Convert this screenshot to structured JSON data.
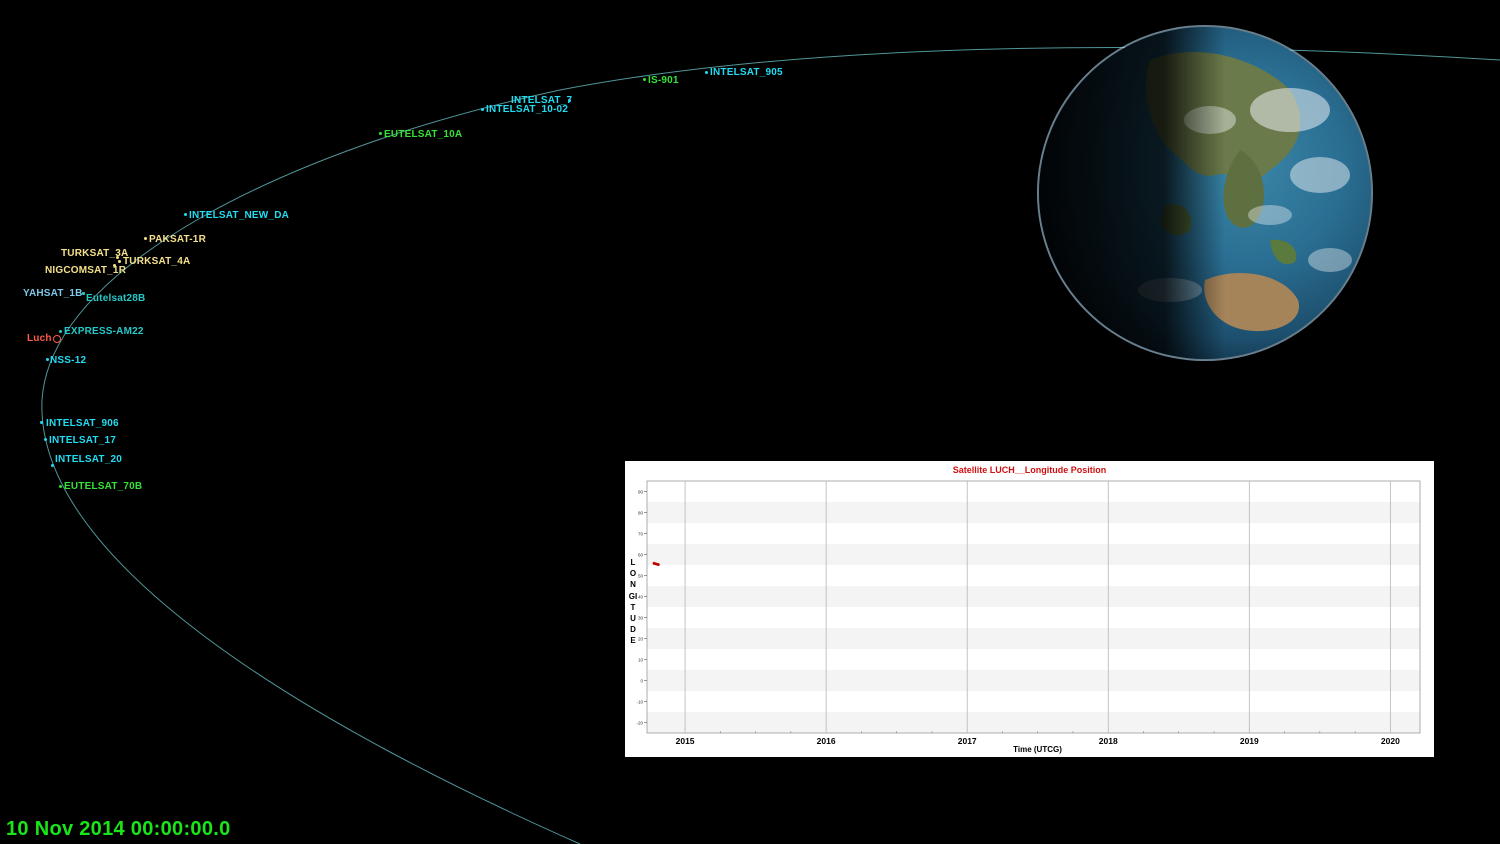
{
  "timestamp": "10 Nov 2014 00:00:00.0",
  "colors": {
    "orbit": "#5fb0b4",
    "cyan": "#22dcf2",
    "green": "#35e235",
    "yellow": "#f4e08a",
    "light_blue": "#7fc8ea",
    "teal": "#25c9c9",
    "luch": "#ff5a4a",
    "chart_red": "#c00000"
  },
  "satellites": [
    {
      "name": "INTELSAT_905",
      "color": "cyan"
    },
    {
      "name": "IS-901",
      "color": "green"
    },
    {
      "name": "INTELSAT_7",
      "color": "cyan"
    },
    {
      "name": "INTELSAT_10-02",
      "color": "cyan"
    },
    {
      "name": "EUTELSAT_10A",
      "color": "green"
    },
    {
      "name": "INTELSAT_NEW_DA",
      "color": "cyan"
    },
    {
      "name": "PAKSAT-1R",
      "color": "yellow"
    },
    {
      "name": "TURKSAT_3A",
      "color": "yellow"
    },
    {
      "name": "TURKSAT_4A",
      "color": "yellow"
    },
    {
      "name": "NIGCOMSAT_1R",
      "color": "yellow"
    },
    {
      "name": "YAHSAT_1B",
      "color": "light_blue"
    },
    {
      "name": "Eutelsat28B",
      "color": "teal"
    },
    {
      "name": "EXPRESS-AM22",
      "color": "teal"
    },
    {
      "name": "Luch",
      "color": "luch"
    },
    {
      "name": "NSS-12",
      "color": "cyan"
    },
    {
      "name": "INTELSAT_906",
      "color": "cyan"
    },
    {
      "name": "INTELSAT_17",
      "color": "cyan"
    },
    {
      "name": "INTELSAT_20",
      "color": "cyan"
    },
    {
      "name": "EUTELSAT_70B",
      "color": "green"
    }
  ],
  "chart_data": {
    "type": "scatter",
    "title": "Satellite LUCH__Longitude Position",
    "xlabel": "Time (UTCG)",
    "ylabel": "LONGITUDE",
    "x_ticks": [
      "2015",
      "2016",
      "2017",
      "2018",
      "2019",
      "2020"
    ],
    "y_ticks": [
      90,
      80,
      70,
      60,
      50,
      40,
      30,
      20,
      10,
      0,
      -10,
      -20
    ],
    "ylim": [
      -25,
      95
    ],
    "xlim": [
      2014.73,
      2020.21
    ],
    "grid": true,
    "series": [
      {
        "color": "#c00000",
        "points": [
          [
            2014.78,
            55.8
          ],
          [
            2014.79,
            55.6
          ],
          [
            2014.8,
            55.4
          ],
          [
            2014.81,
            55.2
          ]
        ]
      }
    ]
  }
}
